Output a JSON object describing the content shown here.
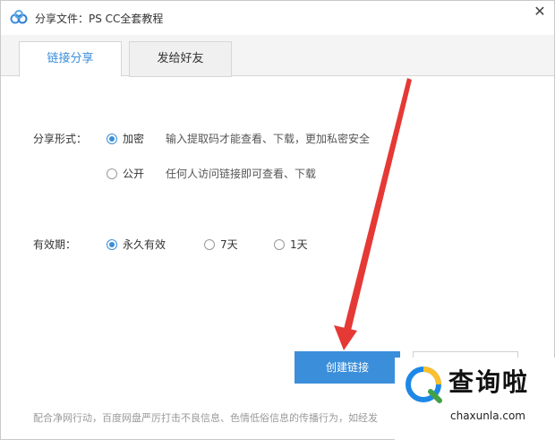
{
  "window": {
    "title": "分享文件：PS CC全套教程",
    "close_glyph": "✕"
  },
  "tabs": [
    {
      "label": "链接分享",
      "active": true
    },
    {
      "label": "发给好友",
      "active": false
    }
  ],
  "share_mode": {
    "label": "分享形式：",
    "options": [
      {
        "label": "加密",
        "desc": "输入提取码才能查看、下载，更加私密安全",
        "checked": true
      },
      {
        "label": "公开",
        "desc": "任何人访问链接即可查看、下载",
        "checked": false
      }
    ]
  },
  "validity": {
    "label": "有效期：",
    "options": [
      {
        "label": "永久有效",
        "checked": true
      },
      {
        "label": "7天",
        "checked": false
      },
      {
        "label": "1天",
        "checked": false
      }
    ]
  },
  "buttons": {
    "create_label": "创建链接"
  },
  "footer": {
    "text": "配合净网行动，百度网盘严厉打击不良信息、色情低俗信息的传播行为，如经发"
  },
  "watermark": {
    "text": "查询啦",
    "url": "chaxunla.com"
  },
  "colors": {
    "accent": "#3b8ed9",
    "arrow": "#e53935"
  }
}
